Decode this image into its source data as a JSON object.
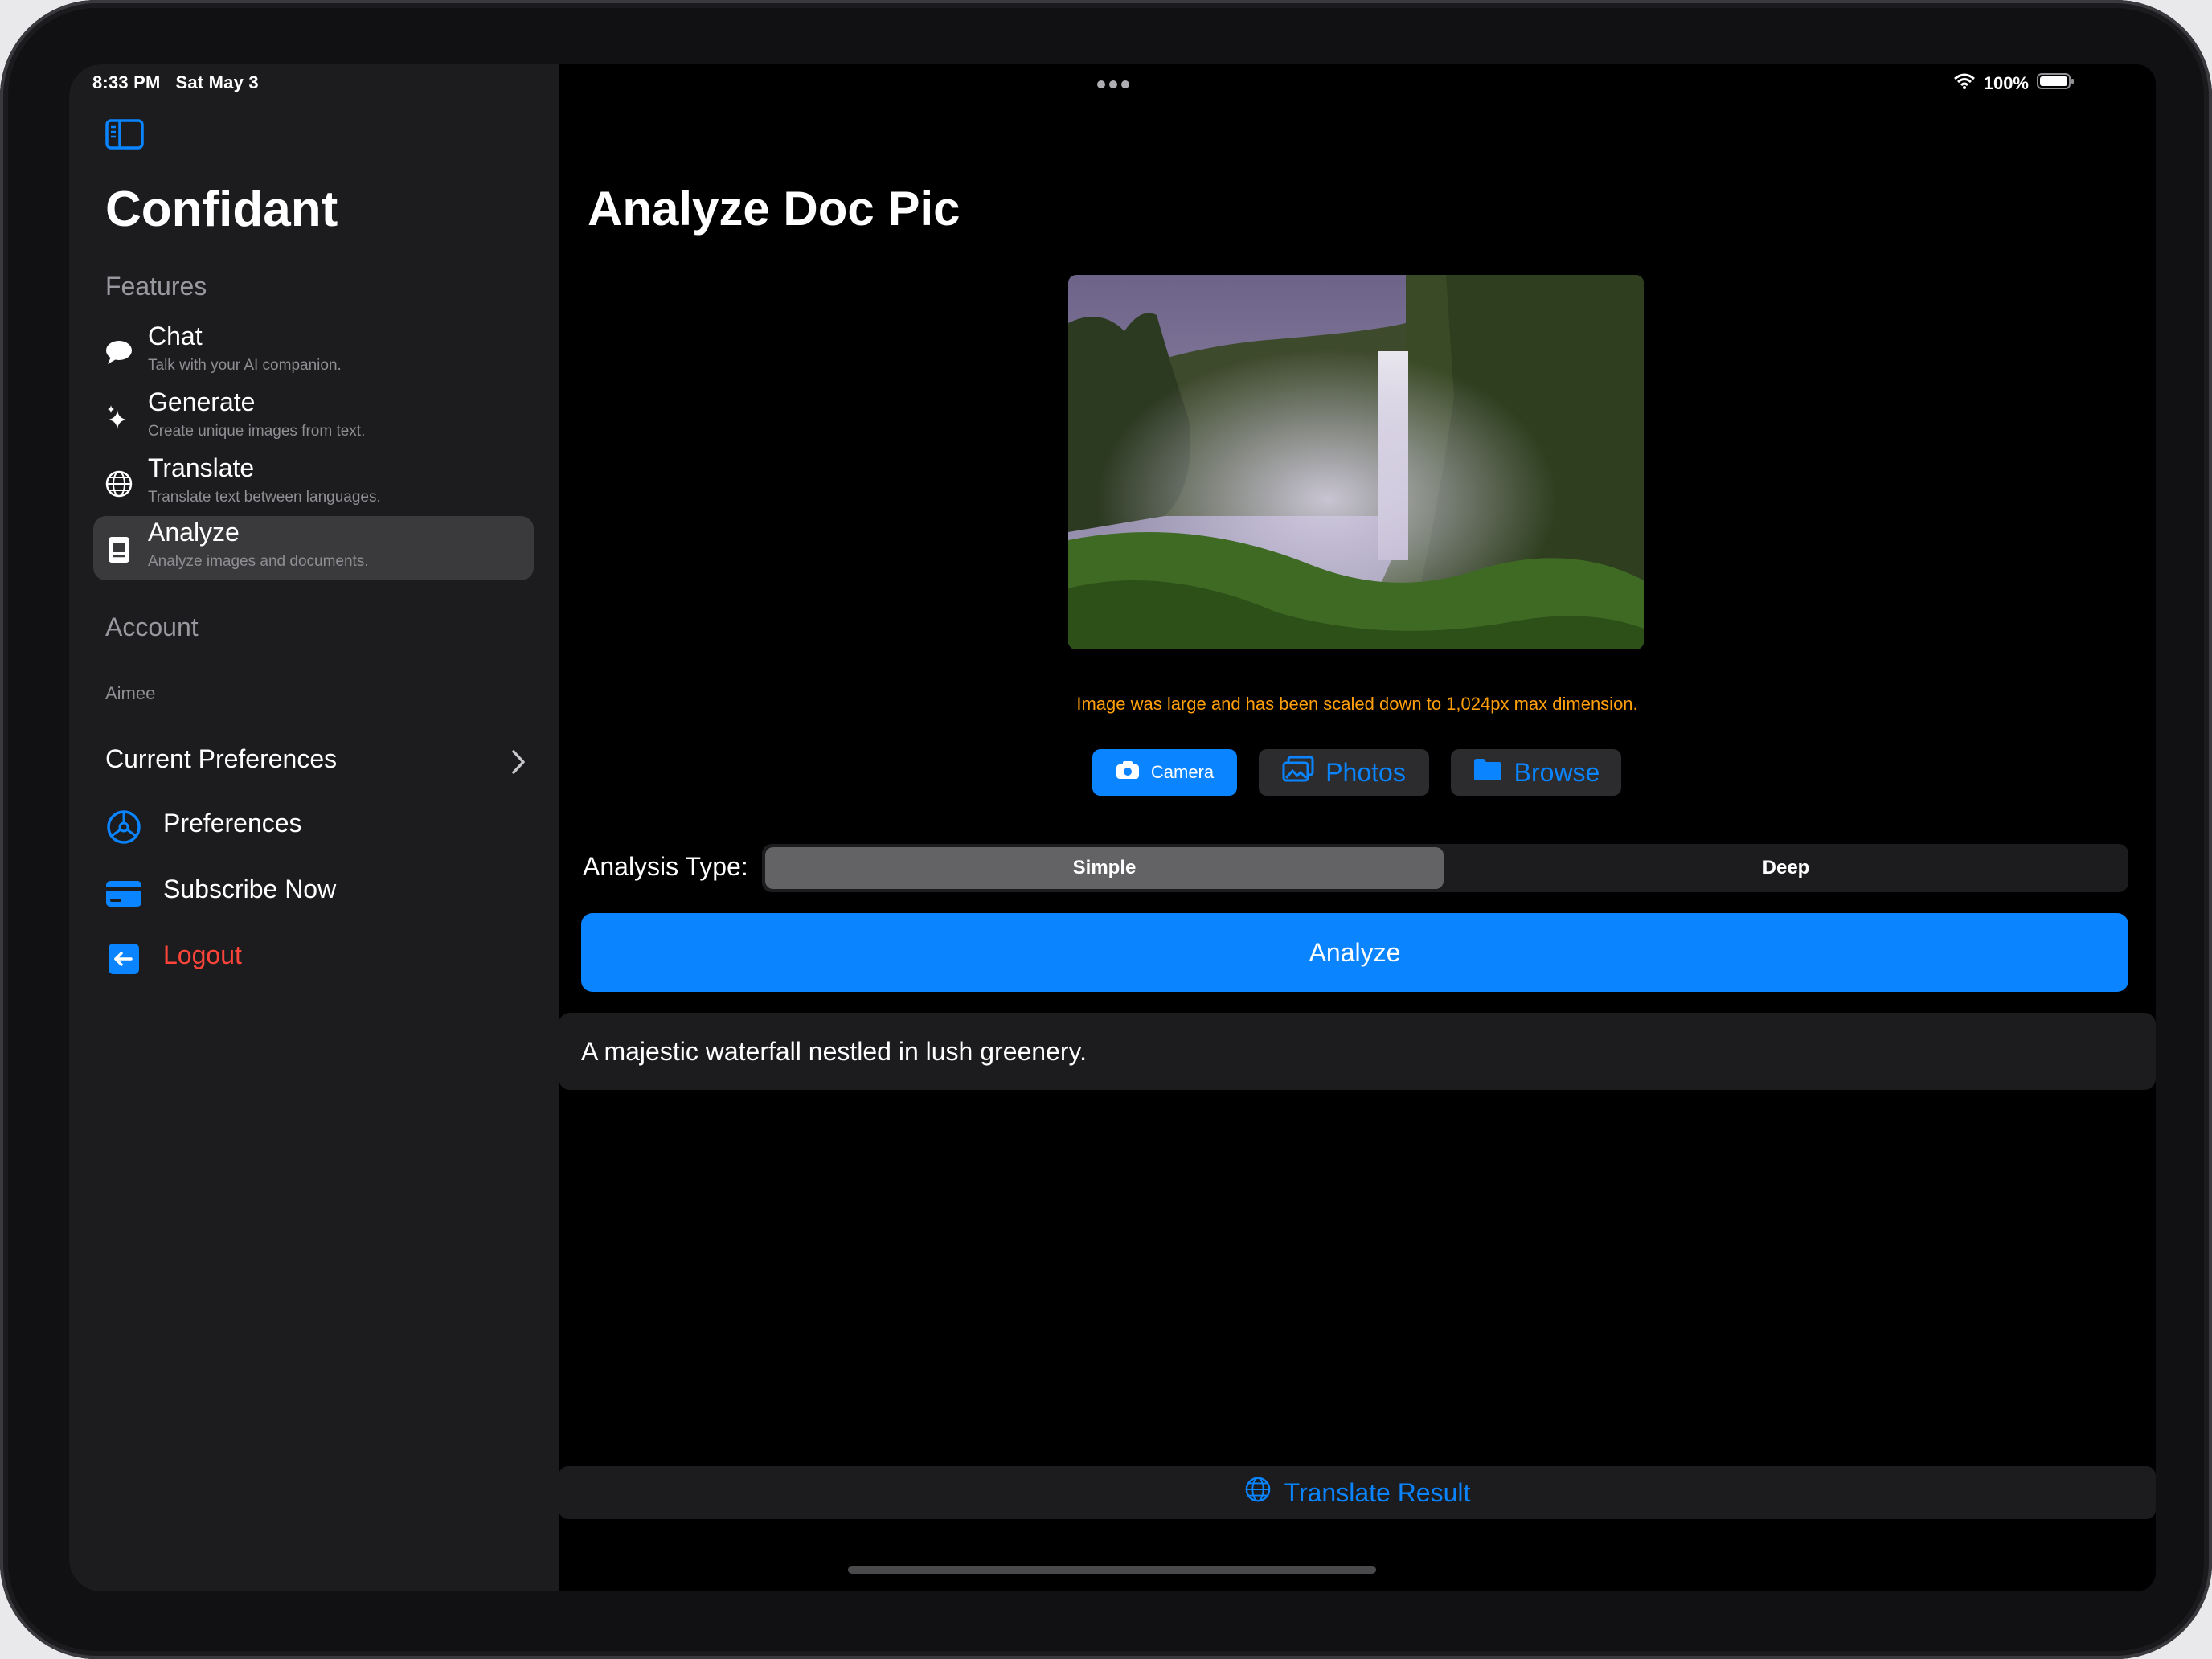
{
  "status_bar": {
    "time": "8:33 PM",
    "date": "Sat May 3",
    "battery": "100%"
  },
  "sidebar": {
    "app_title": "Confidant",
    "features_header": "Features",
    "items": [
      {
        "title": "Chat",
        "subtitle": "Talk with your AI companion.",
        "icon": "chat-bubble-icon"
      },
      {
        "title": "Generate",
        "subtitle": "Create unique images from text.",
        "icon": "sparkles-icon"
      },
      {
        "title": "Translate",
        "subtitle": "Translate text between languages.",
        "icon": "globe-icon"
      },
      {
        "title": "Analyze",
        "subtitle": "Analyze images and documents.",
        "icon": "document-scan-icon",
        "selected": true
      }
    ],
    "account_header": "Account",
    "account_name": "Aimee",
    "current_preferences": "Current Preferences",
    "preferences": "Preferences",
    "subscribe": "Subscribe Now",
    "logout": "Logout"
  },
  "main": {
    "title": "Analyze Doc Pic",
    "scale_note": "Image was large and has been scaled down to 1,024px max dimension.",
    "sources": {
      "camera": "Camera",
      "photos": "Photos",
      "browse": "Browse"
    },
    "analysis_type_label": "Analysis Type:",
    "segments": {
      "simple": "Simple",
      "deep": "Deep",
      "selected": "Simple"
    },
    "analyze_button": "Analyze",
    "result": "A majestic waterfall nestled in lush greenery.",
    "translate_button": "Translate Result"
  },
  "colors": {
    "accent": "#0a84ff",
    "warning": "#ff9f0a",
    "logout": "#ff453a",
    "sidebar_bg": "#1c1c1e"
  }
}
